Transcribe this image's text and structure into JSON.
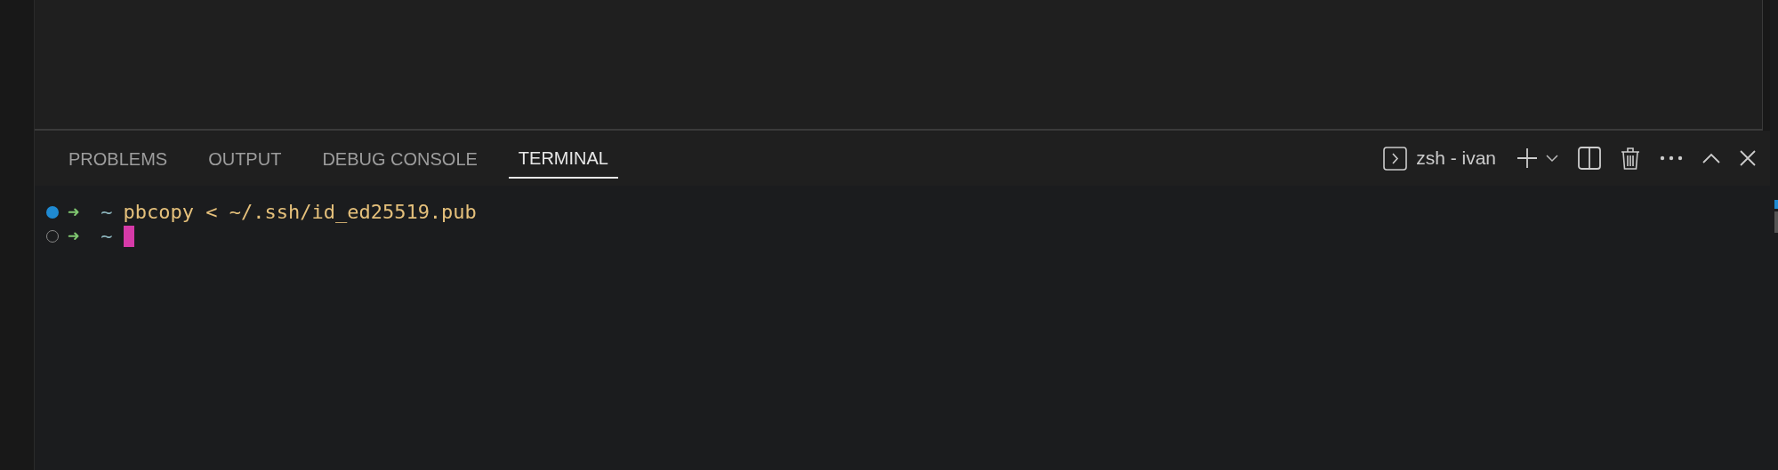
{
  "panel": {
    "tabs": [
      {
        "label": "PROBLEMS",
        "selected": false
      },
      {
        "label": "OUTPUT",
        "selected": false
      },
      {
        "label": "DEBUG CONSOLE",
        "selected": false
      },
      {
        "label": "TERMINAL",
        "selected": true
      }
    ],
    "terminal_name": "zsh - ivan"
  },
  "terminal": {
    "lines": [
      {
        "finished": true,
        "prompt": "➜",
        "cwd": "~",
        "command": "pbcopy < ~/.ssh/id_ed25519.pub",
        "cursor": false
      },
      {
        "finished": false,
        "prompt": "➜",
        "cwd": "~",
        "cursor": true
      }
    ]
  }
}
